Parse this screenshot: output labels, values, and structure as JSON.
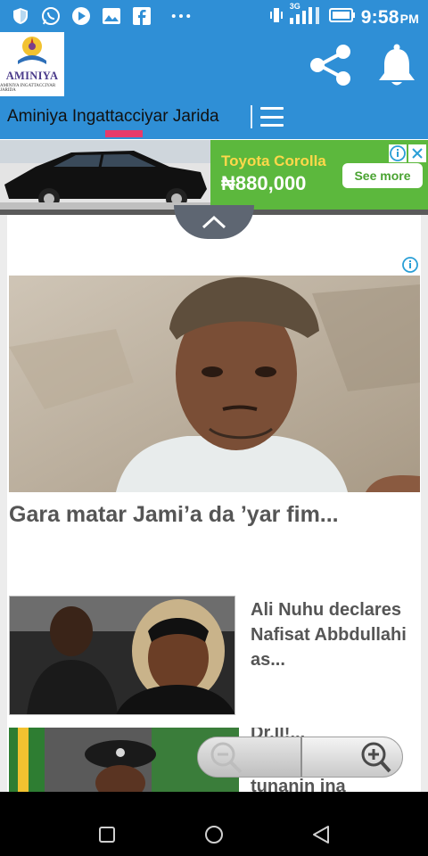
{
  "status_bar": {
    "network": "3G",
    "time": "9:58",
    "ampm": "PM",
    "icons": [
      "shield-icon",
      "whatsapp-icon",
      "play-icon",
      "image-icon",
      "facebook-icon",
      "more-icon"
    ]
  },
  "app_bar": {
    "logo_word": "AMINIYA",
    "logo_subtitle": "AMINIYA INGATTACCIYAR JARIDA",
    "share_icon": "share-icon",
    "bell_icon": "notification-bell-icon"
  },
  "tabs": {
    "title": "Aminiya Ingattacciyar Jarida",
    "menu_icon": "hamburger-menu-icon"
  },
  "ad": {
    "model": "Toyota Corolla",
    "price": "₦880,000",
    "cta": "See more"
  },
  "feed": {
    "featured": {
      "title": "Gara matar Jami’a da ’yar fim..."
    },
    "stories": [
      {
        "title": "Ali Nuhu declares Nafisat Abbdullahi as..."
      },
      {
        "title_line1": "Dr.ll!...",
        "title_line2": "tunanin ina"
      }
    ]
  },
  "colors": {
    "primary": "#2f8fd6",
    "accent": "#e83a6a",
    "ad_green": "#5cb83d",
    "ad_yellow": "#ffd84a",
    "title_gray": "#555555"
  }
}
